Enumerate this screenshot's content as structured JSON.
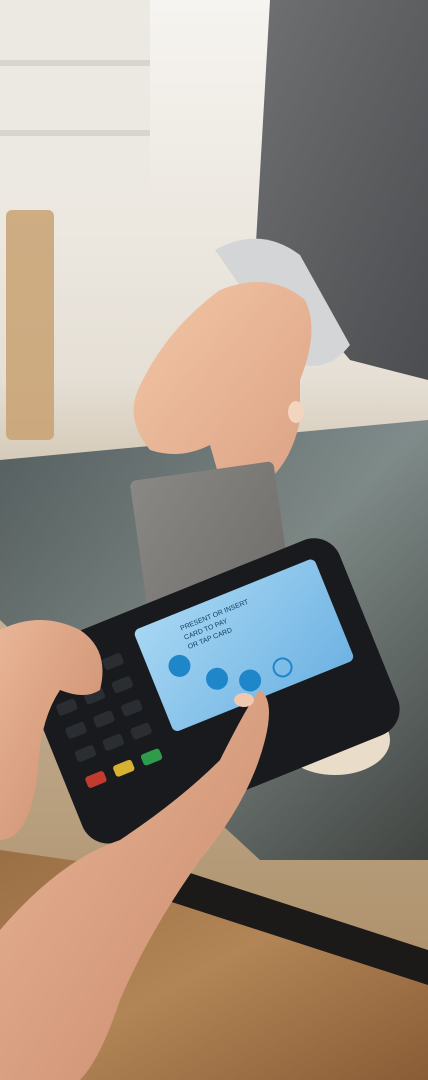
{
  "photo": {
    "subject": "Customer holding a gray payment card over a handheld card terminal held by another person at a shop counter"
  },
  "terminal": {
    "screen_text_line1": "PRESENT OR INSERT",
    "screen_text_line2": "CARD TO PAY",
    "screen_text_line3": "OR TAP CARD",
    "screen_icons": [
      "contactless-icon",
      "chip-icon",
      "swipe-icon",
      "tap-icon"
    ],
    "colors": {
      "screen": "#88c7ee",
      "icon": "#1f86c9",
      "body": "#181a1d",
      "cancel_key": "#c33b2e",
      "ok_key": "#2e9c4b",
      "clear_key": "#d8b032"
    }
  },
  "card": {
    "color": "#7d7b78",
    "chip_color": "#c9a65f"
  }
}
